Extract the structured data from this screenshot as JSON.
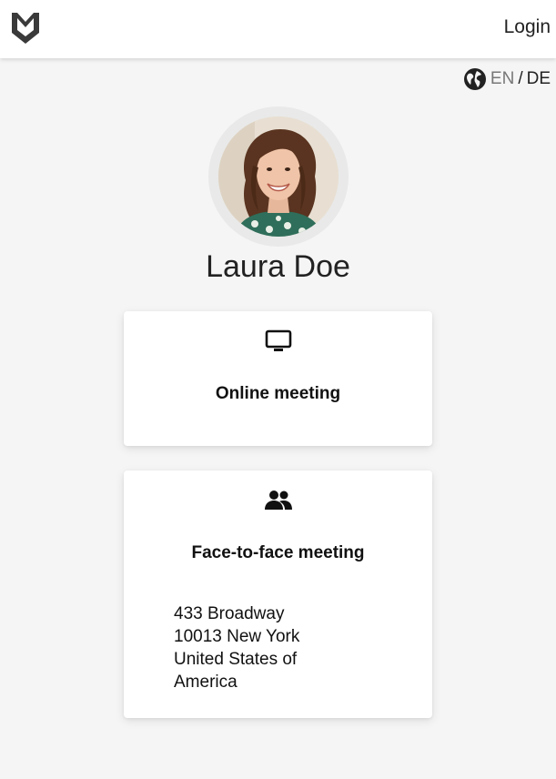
{
  "header": {
    "logo_icon": "brand-logo-icon",
    "login_label": "Login"
  },
  "language": {
    "icon": "globe-icon",
    "en": "EN",
    "separator": "/",
    "de": "DE"
  },
  "profile": {
    "name": "Laura Doe",
    "avatar": "profile-photo"
  },
  "meeting_options": [
    {
      "icon": "monitor-icon",
      "title": "Online meeting"
    },
    {
      "icon": "people-icon",
      "title": "Face-to-face meeting",
      "address": [
        "433 Broadway",
        "10013 New York",
        "United States of",
        "America"
      ]
    }
  ],
  "colors": {
    "background": "#f5f5f5",
    "card": "#ffffff",
    "text": "#111111",
    "muted": "#777777"
  }
}
